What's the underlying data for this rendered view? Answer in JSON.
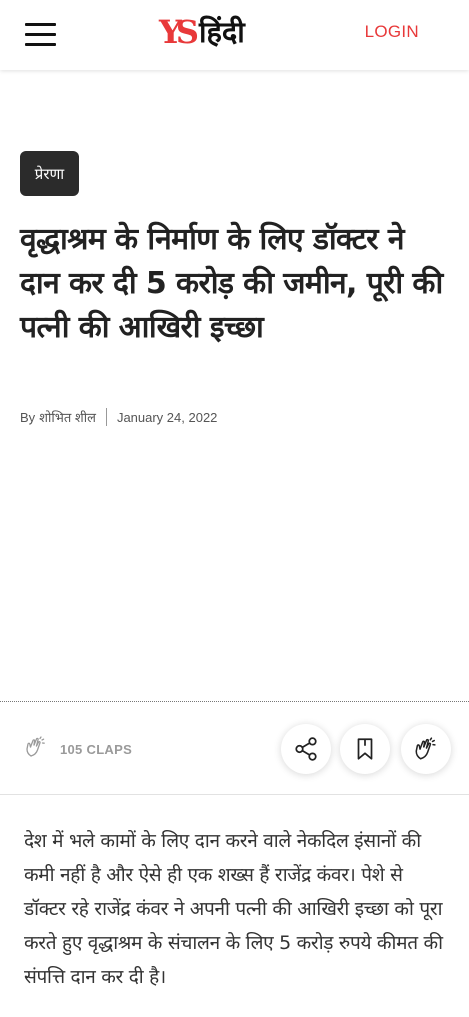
{
  "header": {
    "logo_ys": "YS",
    "logo_hindi": "हिंदी",
    "login_label": "LOGIN",
    "menu_icon": "hamburger-icon",
    "accent_color": "#e8393a"
  },
  "article": {
    "category": "प्रेरणा",
    "title": "वृद्धाश्रम के निर्माण के लिए डॉक्टर ने दान कर दी 5 करोड़ की जमीन, पूरी की पत्नी की आखिरी इच्छा",
    "byline_prefix": "By",
    "author": "शोभित शील",
    "date": "January 24, 2022",
    "body": "देश में भले कामों के लिए दान करने वाले नेकदिल इंसानों की कमी नहीं है और ऐसे ही एक शख्स हैं राजेंद्र कंवर। पेशे से डॉक्टर रहे राजेंद्र कंवर ने अपनी पत्नी की आखिरी इच्छा को पूरा करते हुए वृद्धाश्रम के संचालन के लिए 5 करोड़ रुपये कीमत की संपत्ति दान कर दी है।"
  },
  "actions": {
    "claps_label": "105 CLAPS",
    "claps_icon": "clap-icon",
    "share_icon": "share-icon",
    "bookmark_icon": "bookmark-icon",
    "clap_button_icon": "clap-icon"
  }
}
